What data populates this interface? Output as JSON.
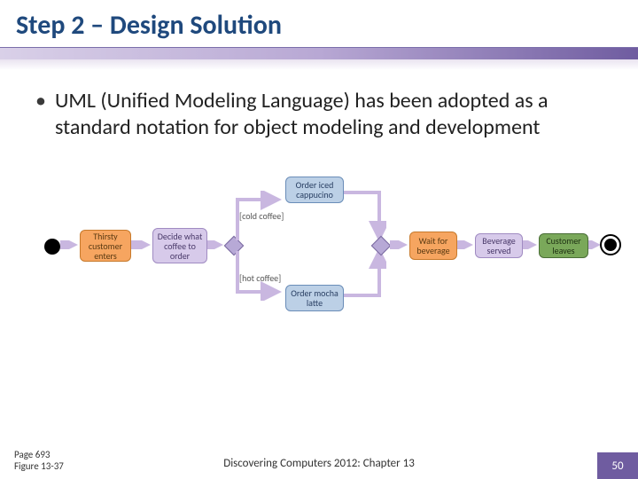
{
  "slide": {
    "title": "Step 2 – Design Solution",
    "bullet": "UML (Unified Modeling Language) has been adopted as a standard notation for object modeling and development"
  },
  "diagram": {
    "nodes": {
      "start": "Thirsty customer enters",
      "decide": "Decide what coffee to order",
      "iced": "Order iced cappucino",
      "mocha": "Order mocha latte",
      "wait": "Wait for beverage",
      "served": "Beverage served",
      "leaves": "Customer leaves"
    },
    "labels": {
      "cold": "[cold coffee]",
      "hot": "[hot coffee]"
    }
  },
  "footer": {
    "page_ref": "Page 693",
    "figure_ref": "Figure 13-37",
    "center": "Discovering Computers 2012: Chapter 13",
    "page_number": "50"
  }
}
